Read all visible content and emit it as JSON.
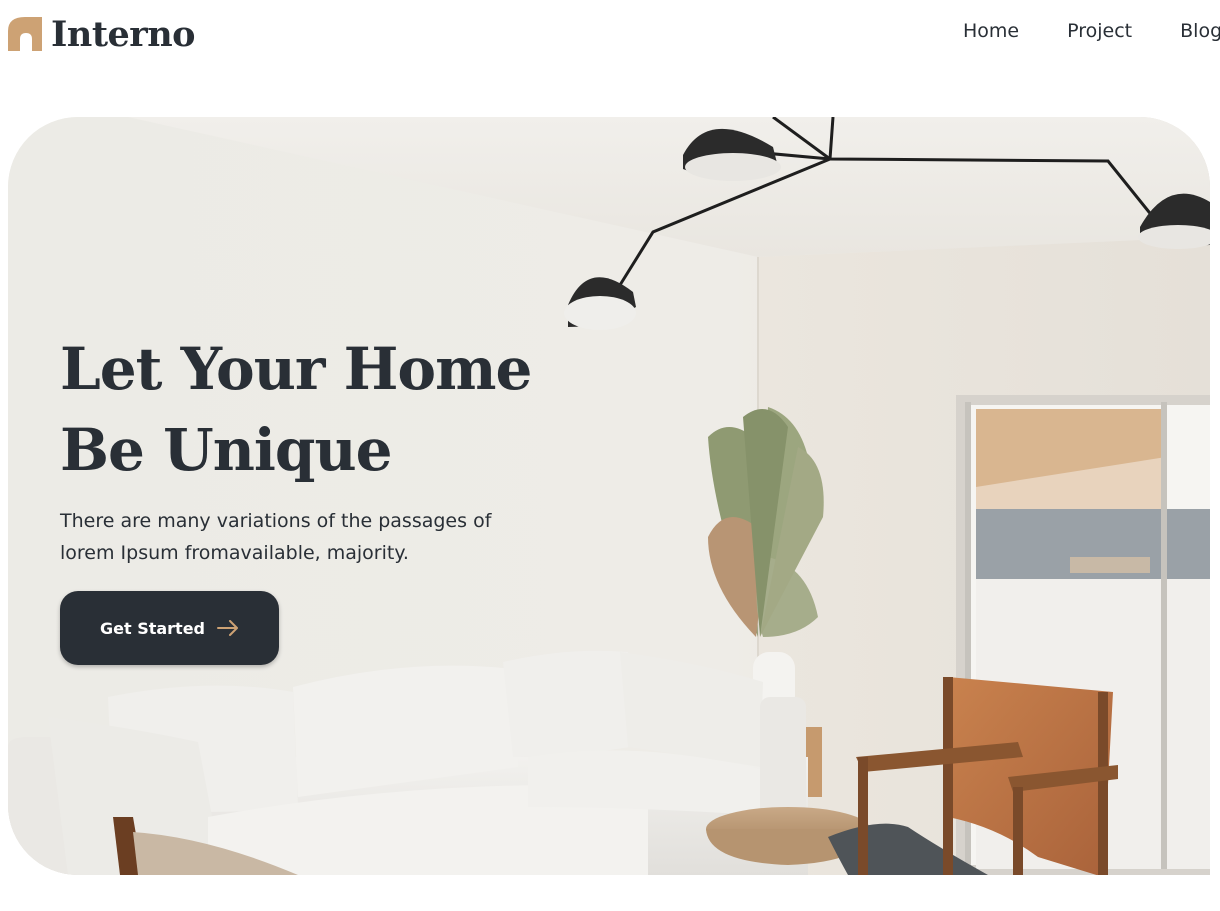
{
  "brand": {
    "name": "Interno",
    "accent": "#cda274",
    "dark": "#292f36"
  },
  "nav": {
    "items": [
      {
        "label": "Home"
      },
      {
        "label": "Project"
      },
      {
        "label": "Blog"
      }
    ]
  },
  "hero": {
    "title_line1": "Let Your Home",
    "title_line2": "Be Unique",
    "description": "There are many variations of the passages of lorem Ipsum fromavailable, majority.",
    "cta_label": "Get Started",
    "cta_icon": "arrow-right-icon",
    "image": "living-room-photo"
  }
}
